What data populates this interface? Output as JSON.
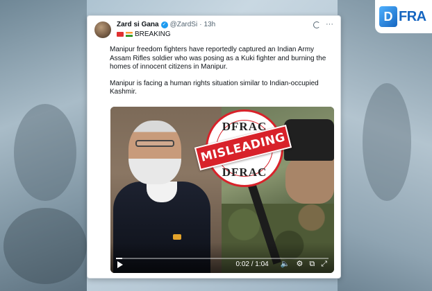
{
  "background": {
    "accent": "#9fb8c8"
  },
  "logo": {
    "mark": "D",
    "text": "FRA"
  },
  "tweet": {
    "author_name": "Zard si Gana",
    "verified_icon": "verified-badge-icon",
    "handle": "@ZardSi",
    "separator": "·",
    "time": "13h",
    "more": "···",
    "badge_text": "BREAKING",
    "paragraph1": "Manipur freedom fighters have reportedly captured an Indian Army Assam Rifles soldier who was posing as a Kuki fighter and burning the homes of innocent citizens in Manipur.",
    "paragraph2": "Manipur is facing a human rights situation similar to Indian-occupied Kashmir."
  },
  "media": {
    "stamp_top": "DFRAC",
    "stamp_bottom": "DFRAC",
    "label": "MISLEADING",
    "progress": 0.03,
    "time_display": "0:02 / 1:04",
    "colors": {
      "stamp": "#d8222a"
    }
  }
}
